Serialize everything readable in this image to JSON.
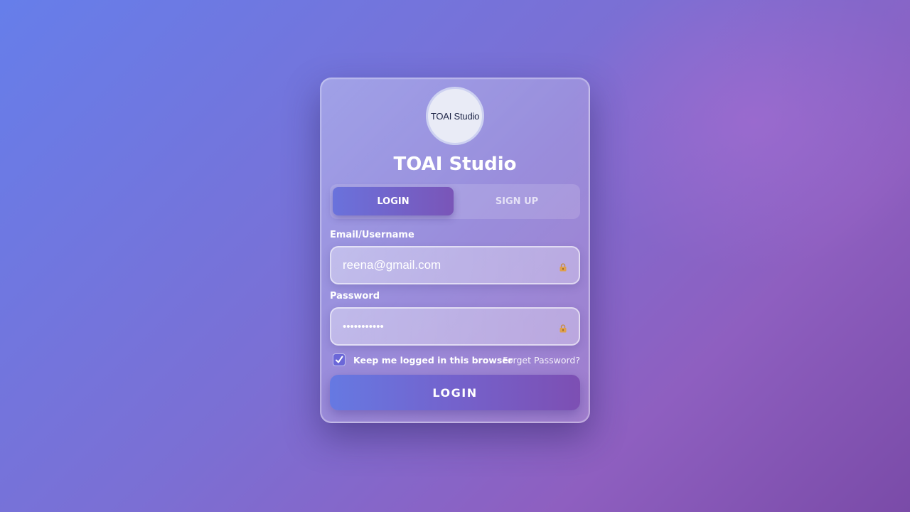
{
  "app": {
    "logo_text": "TOAI Studio",
    "title": "TOAI Studio"
  },
  "tabs": [
    {
      "label": "LOGIN",
      "active": true
    },
    {
      "label": "SIGN UP",
      "active": false
    }
  ],
  "form": {
    "email_label": "Email/Username",
    "email_value": "reena@gmail.com",
    "password_label": "Password",
    "password_value": "•••••••••••",
    "remember_label": "Keep me logged in this browser",
    "remember_checked": true,
    "forgot_label": "Forget Password?",
    "submit_label": "LOGIN"
  },
  "icons": {
    "field_icon": "lock-icon",
    "check": "checkmark-icon"
  },
  "colors": {
    "bg_start": "#667eea",
    "bg_end": "#7a4ba8",
    "accent": "#6a72dc",
    "accent_end": "#7d4fb3"
  }
}
